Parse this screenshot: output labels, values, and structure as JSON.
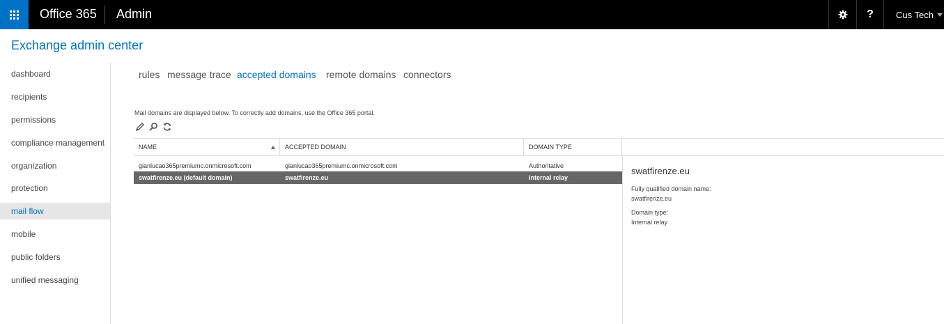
{
  "topbar": {
    "brand": "Office 365",
    "app": "Admin",
    "help": "?",
    "user": "Cus Tech"
  },
  "page_title": "Exchange admin center",
  "nav": [
    "dashboard",
    "recipients",
    "permissions",
    "compliance management",
    "organization",
    "protection",
    "mail flow",
    "mobile",
    "public folders",
    "unified messaging"
  ],
  "active_nav": "mail flow",
  "tabs": [
    "rules",
    "message trace",
    "accepted domains",
    "remote domains",
    "connectors"
  ],
  "active_tab": "accepted domains",
  "description": "Mail domains are displayed below. To correctly add domains, use the Office 365 portal.",
  "toolbar": [
    "edit-icon",
    "search-icon",
    "refresh-icon"
  ],
  "table": {
    "columns": [
      "NAME",
      "ACCEPTED DOMAIN",
      "DOMAIN TYPE"
    ],
    "rows": [
      [
        "gianlucao365premiumc.onmicrosoft.com",
        "gianlucao365premiumc.onmicrosoft.com",
        "Authoritative"
      ],
      [
        "swatfirenze.eu (default domain)",
        "swatfirenze.eu",
        "Internal relay"
      ]
    ]
  },
  "details": {
    "title": "swatfirenze.eu",
    "fqdn_label": "Fully qualified domain name:",
    "fqdn_value": "swatfirenze.eu",
    "type_label": "Domain type:",
    "type_value": "Internal relay"
  },
  "colors": {
    "accent": "#0072c6",
    "selected_row": "#666666"
  }
}
